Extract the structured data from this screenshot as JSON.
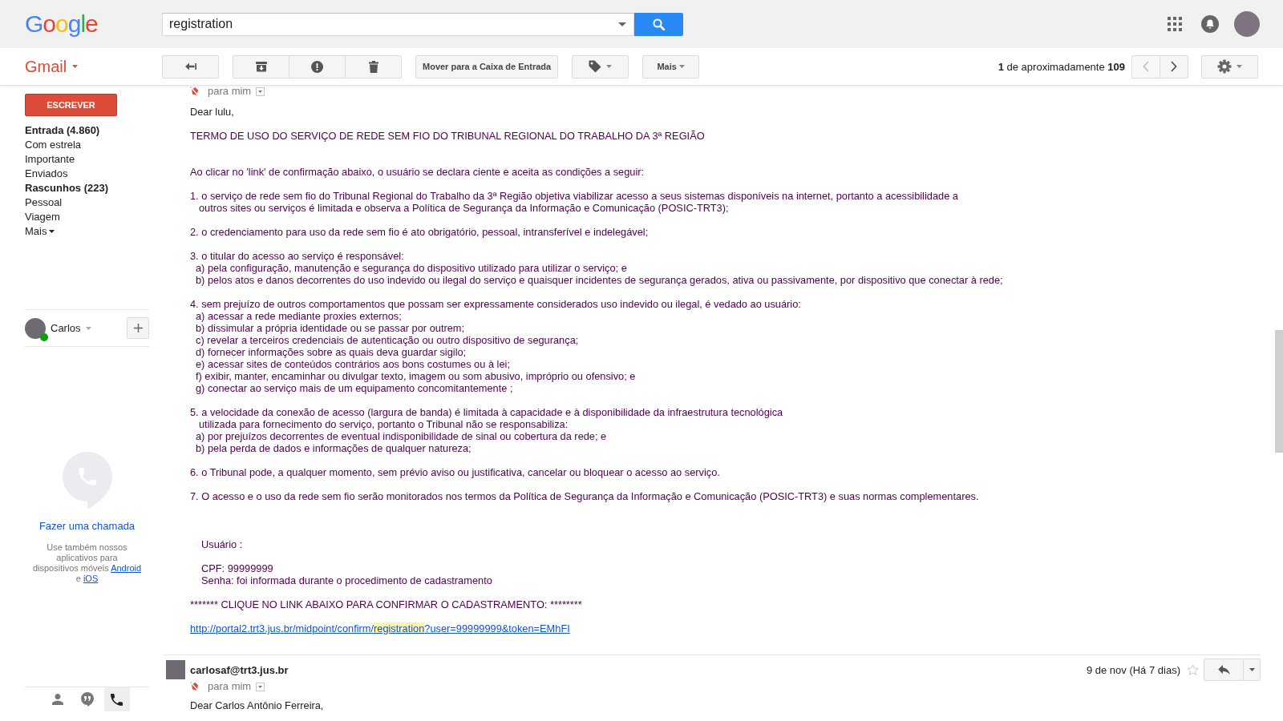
{
  "header": {
    "logo": "Google",
    "search": {
      "value": "registration"
    }
  },
  "toolbar": {
    "app_name": "Gmail",
    "move_button": "Mover para a Caixa de Entrada",
    "more_button": "Mais",
    "pagination": "**1** de aproximadamente **109**",
    "pager": [
      {
        "kind": "newer",
        "disabled": true
      },
      {
        "kind": "older",
        "disabled": false
      }
    ]
  },
  "sidebar": {
    "compose_button": "ESCREVER",
    "folders": [
      {
        "label": "Entrada (4.860)",
        "unread": true,
        "selected": false
      },
      {
        "label": "Com estrela",
        "unread": false,
        "selected": false
      },
      {
        "label": "Importante",
        "unread": false,
        "selected": false
      },
      {
        "label": "Enviados",
        "unread": false,
        "selected": false
      },
      {
        "label": "Rascunhos (223)",
        "unread": true,
        "selected": false
      },
      {
        "label": "Pessoal",
        "unread": false,
        "selected": false
      },
      {
        "label": "Viagem",
        "unread": false,
        "selected": false
      }
    ],
    "more_link": "Mais",
    "hangouts": {
      "user": "Carlos",
      "online": true
    },
    "call_link": "Fazer uma chamada",
    "apps_note": [
      {
        "kind": "text",
        "text": "Use também nossos aplicativos para dispositivos móveis"
      },
      {
        "kind": "link",
        "text": "Android"
      },
      {
        "kind": "text",
        "text": "e"
      },
      {
        "kind": "link",
        "text": "iOS"
      }
    ],
    "bottom_tabs": [
      {
        "kind": "contacts",
        "selected": false
      },
      {
        "kind": "chat",
        "selected": false
      },
      {
        "kind": "phone",
        "selected": true
      }
    ]
  },
  "thread": {
    "messages": [
      {
        "recipient": "para mim",
        "greeting": "Dear lulu,",
        "title": "TERMO DE USO DO SERVIÇO DE REDE SEM FIO DO TRIBUNAL REGIONAL DO TRABALHO DA 3ª REGIÃO",
        "intro": "Ao clicar no 'link' de confirmação abaixo, o usuário se declara ciente e aceita as condições a seguir:",
        "clauses": [
          {
            "lines": [
              "1. o serviço de rede sem fio do Tribunal Regional do Trabalho da 3ª Região objetiva viabilizar acesso a seus sistemas disponíveis na internet, portanto a acessibilidade a",
              "outros sites ou serviços é limitada e observa a Política de Segurança da Informação e Comunicação (POSIC-TRT3);"
            ]
          },
          {
            "lines": [
              "2. o credenciamento para uso da rede sem fio é ato obrigatório, pessoal, intransferível e indelegável;"
            ]
          },
          {
            "lines": [
              "3. o titular do acesso ao serviço é responsável:"
            ],
            "children": [
              "a) pela configuração, manutenção e segurança do dispositivo utilizado para utilizar o serviço; e",
              "b) pelos atos e danos decorrentes do uso indevido ou ilegal do serviço e quaisquer incidentes de segurança gerados, ativa ou passivamente, por dispositivo que conectar à rede;"
            ]
          },
          {
            "lines": [
              "4. sem prejuízo de outros comportamentos que possam ser expressamente considerados uso indevido ou ilegal, é vedado ao usuário:"
            ],
            "children": [
              "a) acessar a rede mediante proxies externos;",
              "b) dissimular a própria identidade ou se passar por outrem;",
              "c) revelar a terceiros credenciais de autenticação ou outro dispositivo de segurança;",
              "d) fornecer informações sobre as quais deva guardar sigilo;",
              "e) acessar sites de conteúdos contrários aos bons costumes ou à lei;",
              "f) exibir, manter, encaminhar ou divulgar texto, imagem ou som abusivo, impróprio ou ofensivo; e",
              "g) conectar ao serviço mais de um equipamento concomitantemente ;"
            ]
          },
          {
            "lines": [
              "5. a velocidade da conexão de acesso (largura de banda) é limitada à capacidade e à disponibilidade da infraestrutura tecnológica",
              "utilizada para fornecimento do serviço, portanto o Tribunal não se responsabiliza:"
            ],
            "children": [
              "a) por prejuízos decorrentes de eventual indisponibilidade de sinal ou cobertura da rede; e",
              "b) pela perda de dados e informações de qualquer natureza;"
            ]
          },
          {
            "lines": [
              "6. o Tribunal pode, a qualquer momento, sem prévio aviso ou justificativa, cancelar ou bloquear o acesso ao serviço."
            ]
          },
          {
            "lines": [
              "7. O acesso e o uso da rede sem fio serão monitorados nos termos da Política de Segurança da Informação e Comunicação (POSIC-TRT3) e suas normas complementares."
            ]
          }
        ],
        "credentials": {
          "heading": "Usuário :",
          "lines": [
            "CPF: 99999999",
            "Senha: foi informada durante o procedimento de cadastramento"
          ]
        },
        "notice": "******* CLIQUE NO LINK ABAIXO PARA CONFIRMAR O CADASTRAMENTO: ********",
        "link": [
          {
            "text": "http://portal2.trt3.jus.br/midpoint/confirm/",
            "highlighted": false
          },
          {
            "text": "registration",
            "highlighted": true
          },
          {
            "text": "?user=99999999&token=EMhFI",
            "highlighted": false
          }
        ]
      },
      {
        "sender": "carlosaf@trt3.jus.br",
        "date": "9 de nov (Há 7 dias)",
        "starred": false,
        "recipient": "para mim",
        "greeting": "Dear Carlos Antônio Ferreira,"
      }
    ]
  }
}
